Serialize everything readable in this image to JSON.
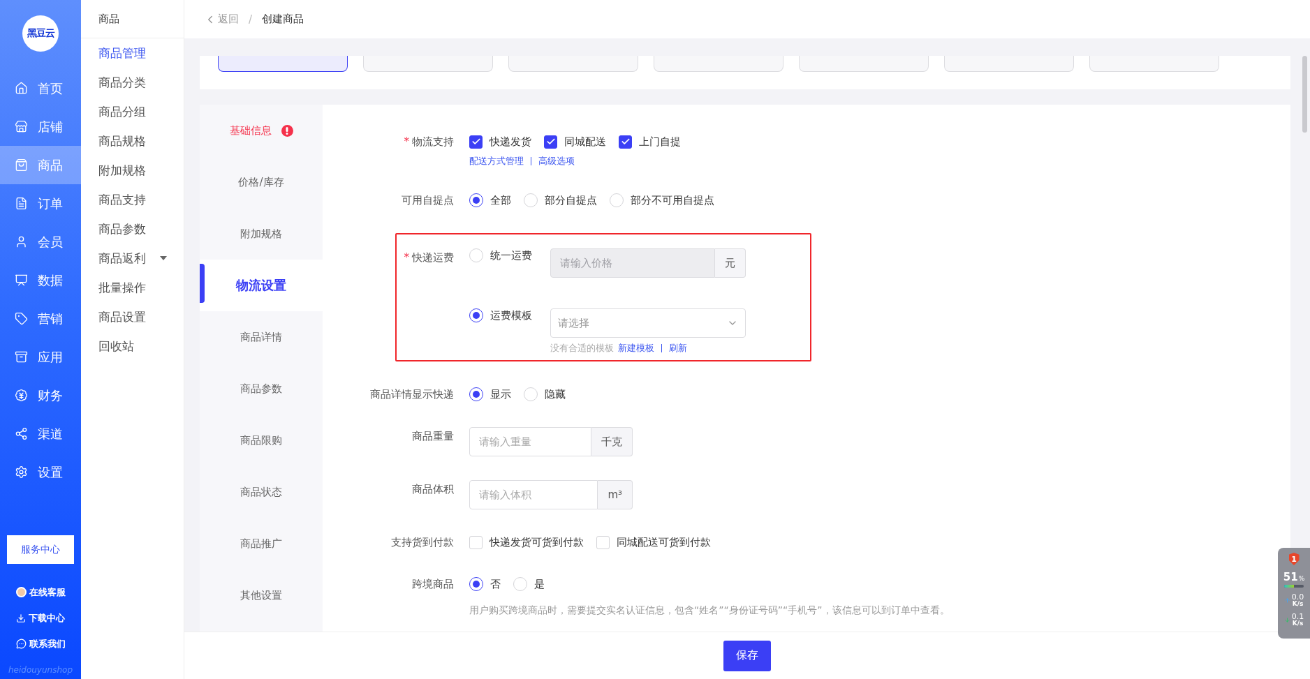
{
  "sidebar": {
    "logo": "黑豆云",
    "items": [
      {
        "label": "首页",
        "selected": false
      },
      {
        "label": "店铺",
        "selected": false
      },
      {
        "label": "商品",
        "selected": true
      },
      {
        "label": "订单",
        "selected": false
      },
      {
        "label": "会员",
        "selected": false
      },
      {
        "label": "数据",
        "selected": false
      },
      {
        "label": "营销",
        "selected": false
      },
      {
        "label": "应用",
        "selected": false
      },
      {
        "label": "财务",
        "selected": false
      },
      {
        "label": "渠道",
        "selected": false
      },
      {
        "label": "设置",
        "selected": false
      }
    ],
    "service_button": "服务中心",
    "links": [
      {
        "label": "在线客服"
      },
      {
        "label": "下载中心"
      },
      {
        "label": "联系我们"
      }
    ],
    "footer": "heidouyunshop"
  },
  "subnav": {
    "title": "商品",
    "items": [
      {
        "label": "商品管理",
        "selected": true,
        "kind": "link"
      },
      {
        "label": "商品分类",
        "selected": false,
        "kind": "link"
      },
      {
        "label": "商品分组",
        "selected": false,
        "kind": "link"
      },
      {
        "label": "商品规格",
        "selected": false,
        "kind": "link"
      },
      {
        "label": "附加规格",
        "selected": false,
        "kind": "link"
      },
      {
        "label": "商品支持",
        "selected": false,
        "kind": "link"
      },
      {
        "label": "商品参数",
        "selected": false,
        "kind": "link"
      },
      {
        "label": "商品返利",
        "selected": false,
        "kind": "group"
      },
      {
        "label": "批量操作",
        "selected": false,
        "kind": "link"
      },
      {
        "label": "商品设置",
        "selected": false,
        "kind": "link"
      },
      {
        "label": "回收站",
        "selected": false,
        "kind": "link"
      }
    ]
  },
  "header": {
    "back": "返回",
    "separator": "/",
    "title": "创建商品"
  },
  "step_tabs": [
    {
      "selected": true
    },
    {
      "selected": false
    },
    {
      "selected": false
    },
    {
      "selected": false
    },
    {
      "selected": false
    },
    {
      "selected": false
    },
    {
      "selected": false
    }
  ],
  "section_nav": [
    {
      "label": "基础信息",
      "selected": false,
      "error": true
    },
    {
      "label": "价格/库存",
      "selected": false,
      "error": false
    },
    {
      "label": "附加规格",
      "selected": false,
      "error": false
    },
    {
      "label": "物流设置",
      "selected": true,
      "error": false
    },
    {
      "label": "商品详情",
      "selected": false,
      "error": false
    },
    {
      "label": "商品参数",
      "selected": false,
      "error": false
    },
    {
      "label": "商品限购",
      "selected": false,
      "error": false
    },
    {
      "label": "商品状态",
      "selected": false,
      "error": false
    },
    {
      "label": "商品推广",
      "selected": false,
      "error": false
    },
    {
      "label": "其他设置",
      "selected": false,
      "error": false
    }
  ],
  "form": {
    "rows": [
      {
        "kind": "checkboxes",
        "label": "物流支持",
        "required_mark": "*",
        "options": [
          {
            "label": "快递发货",
            "checked": true
          },
          {
            "label": "同城配送",
            "checked": true
          },
          {
            "label": "上门自提",
            "checked": true
          }
        ],
        "links": [
          "配送方式管理",
          "高级选项"
        ]
      },
      {
        "kind": "radios",
        "label": "可用自提点",
        "options": [
          {
            "label": "全部",
            "selected": true
          },
          {
            "label": "部分自提点",
            "selected": false
          },
          {
            "label": "部分不可用自提点",
            "selected": false
          }
        ]
      },
      {
        "kind": "shipping",
        "label": "快递运费",
        "required_mark": "*",
        "highlighted": true,
        "unified": {
          "label": "统一运费",
          "selected": false,
          "placeholder": "请输入价格",
          "suffix": "元",
          "disabled": true
        },
        "template": {
          "label": "运费模板",
          "selected": true,
          "placeholder": "请选择",
          "hint": "没有合适的模板",
          "links": [
            "新建模板",
            "刷新"
          ]
        }
      },
      {
        "kind": "radios",
        "label": "商品详情显示快递",
        "options": [
          {
            "label": "显示",
            "selected": true
          },
          {
            "label": "隐藏",
            "selected": false
          }
        ]
      },
      {
        "kind": "input",
        "label": "商品重量",
        "placeholder": "请输入重量",
        "suffix": "千克"
      },
      {
        "kind": "input",
        "label": "商品体积",
        "placeholder": "请输入体积",
        "suffix": "m³"
      },
      {
        "kind": "checkboxes",
        "label": "支持货到付款",
        "options": [
          {
            "label": "快递发货可货到付款",
            "checked": false
          },
          {
            "label": "同城配送可货到付款",
            "checked": false
          }
        ]
      },
      {
        "kind": "radios",
        "label": "跨境商品",
        "options": [
          {
            "label": "否",
            "selected": true
          },
          {
            "label": "是",
            "selected": false
          }
        ],
        "hint": "用户购买跨境商品时，需要提交实名认证信息，包含“姓名”“身份证号码”“手机号”，该信息可以到订单中查看。"
      }
    ]
  },
  "save_button": "保存",
  "monitor": {
    "alerts": "1",
    "cpu": "51",
    "cpu_unit": "%",
    "level": 0.51,
    "upload": "0.0",
    "upload_unit": "K/s",
    "download": "0.1",
    "download_unit": "K/s"
  }
}
